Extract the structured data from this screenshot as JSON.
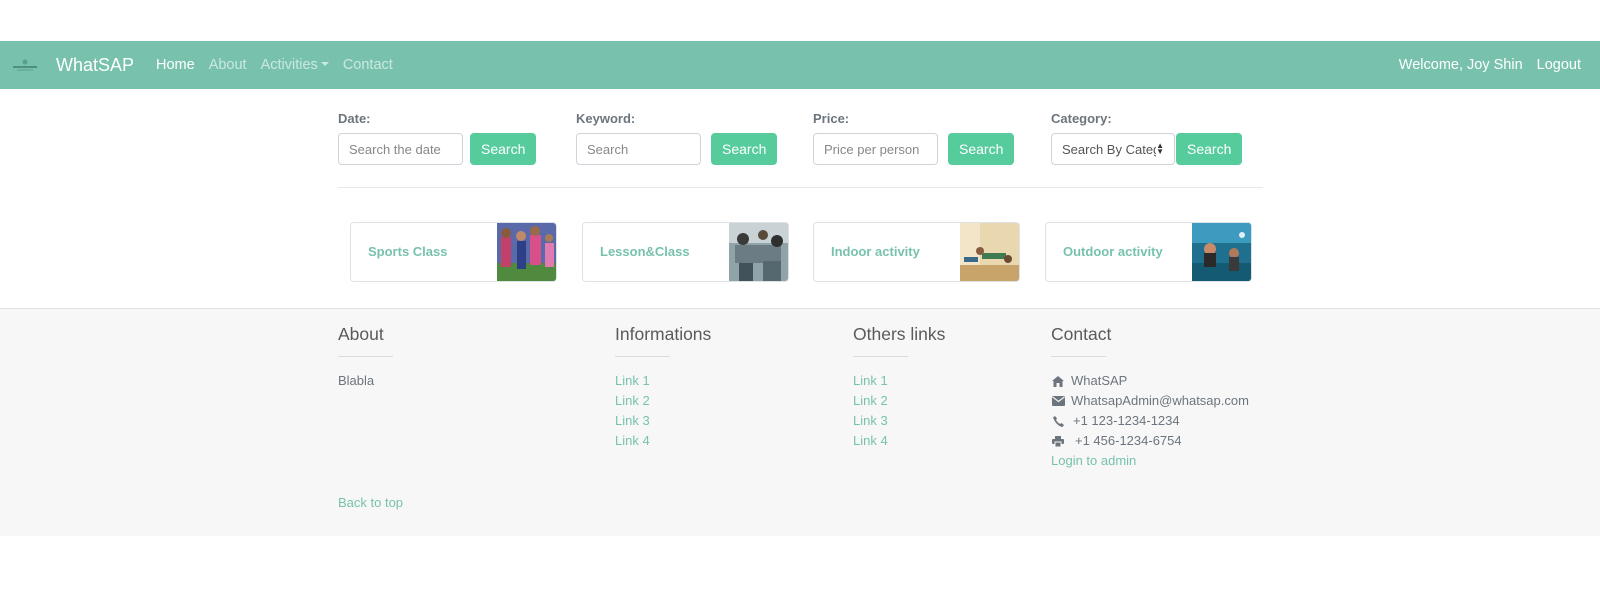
{
  "navbar": {
    "brand": "WhatSAP",
    "logo_icon": "whatsap-logo-icon",
    "links": [
      {
        "label": "Home",
        "active": true
      },
      {
        "label": "About",
        "active": false
      },
      {
        "label": "Activities",
        "active": false,
        "dropdown": true
      },
      {
        "label": "Contact",
        "active": false
      }
    ],
    "welcome": "Welcome, Joy Shin",
    "logout": "Logout",
    "color": "#78c2ad"
  },
  "search": {
    "date": {
      "label": "Date:",
      "placeholder": "Search the date",
      "button": "Search"
    },
    "keyword": {
      "label": "Keyword:",
      "placeholder": "Search",
      "button": "Search"
    },
    "price": {
      "label": "Price:",
      "placeholder": "Price per person",
      "button": "Search"
    },
    "category": {
      "label": "Category:",
      "selected": "Search By Category",
      "button": "Search"
    },
    "button_color": "#56cc9d"
  },
  "categories": [
    {
      "title": "Sports Class",
      "image": "sports-class-photo"
    },
    {
      "title": "Lesson&Class",
      "image": "lesson-class-photo"
    },
    {
      "title": "Indoor activity",
      "image": "indoor-activity-photo"
    },
    {
      "title": "Outdoor activity",
      "image": "outdoor-activity-photo"
    }
  ],
  "footer": {
    "about": {
      "heading": "About",
      "text": "Blabla"
    },
    "informations": {
      "heading": "Informations",
      "links": [
        "Link 1",
        "Link 2",
        "Link 3",
        "Link 4"
      ]
    },
    "others": {
      "heading": "Others links",
      "links": [
        "Link 1",
        "Link 2",
        "Link 3",
        "Link 4"
      ]
    },
    "contact": {
      "heading": "Contact",
      "name": "WhatSAP",
      "email": "WhatsapAdmin@whatsap.com",
      "phone": "+1 123-1234-1234",
      "fax": "+1 456-1234-6754",
      "admin_link": "Login to admin"
    },
    "back_to_top": "Back to top"
  }
}
